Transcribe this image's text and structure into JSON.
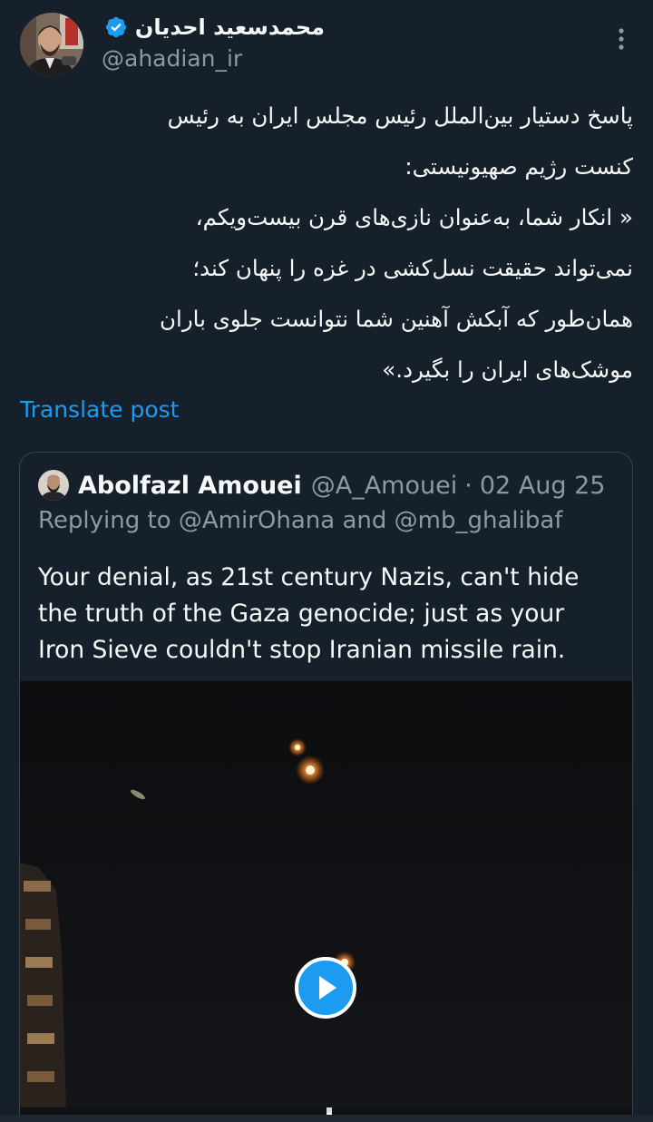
{
  "tweet": {
    "author": {
      "display_name": "محمدسعید احدیان",
      "handle": "@ahadian_ir",
      "verified_icon": "verified-badge-icon",
      "avatar_icon": "avatar-photo"
    },
    "more_icon": "more-vertical-icon",
    "text_lines": [
      "پاسخ دستیار بین‌الملل رئیس مجلس ایران به رئیس",
      "کنست رژیم صهیونیستی:",
      "« انکار شما، به‌عنوان نازی‌های قرن بیست‌ویکم،",
      "نمی‌تواند حقیقت نسل‌کشی در غزه را پنهان کند؛",
      "همان‌طور که آبکش آهنین شما نتوانست جلوی باران",
      "موشک‌های ایران را بگیرد.»"
    ],
    "translate_label": "Translate post"
  },
  "quote": {
    "author": {
      "display_name": "Abolfazl Amouei",
      "handle": "@A_Amouei",
      "separator": "·",
      "date": "02 Aug 25"
    },
    "reply_prefix": "Replying to",
    "reply_to": [
      "@AmirOhana",
      "@mb_ghalibaf"
    ],
    "reply_joiner": "and",
    "text_lines": [
      "Your denial, as 21st century Nazis, can't hide",
      "the truth of the Gaza genocide; just as your",
      "Iron Sieve couldn't stop Iranian missile rain."
    ],
    "media": {
      "type": "video",
      "play_icon": "play-icon"
    }
  },
  "colors": {
    "background": "#15202b",
    "text": "#f7f9f9",
    "secondary_text": "#8b98a5",
    "link": "#1d9bf0",
    "border": "#38444d"
  }
}
